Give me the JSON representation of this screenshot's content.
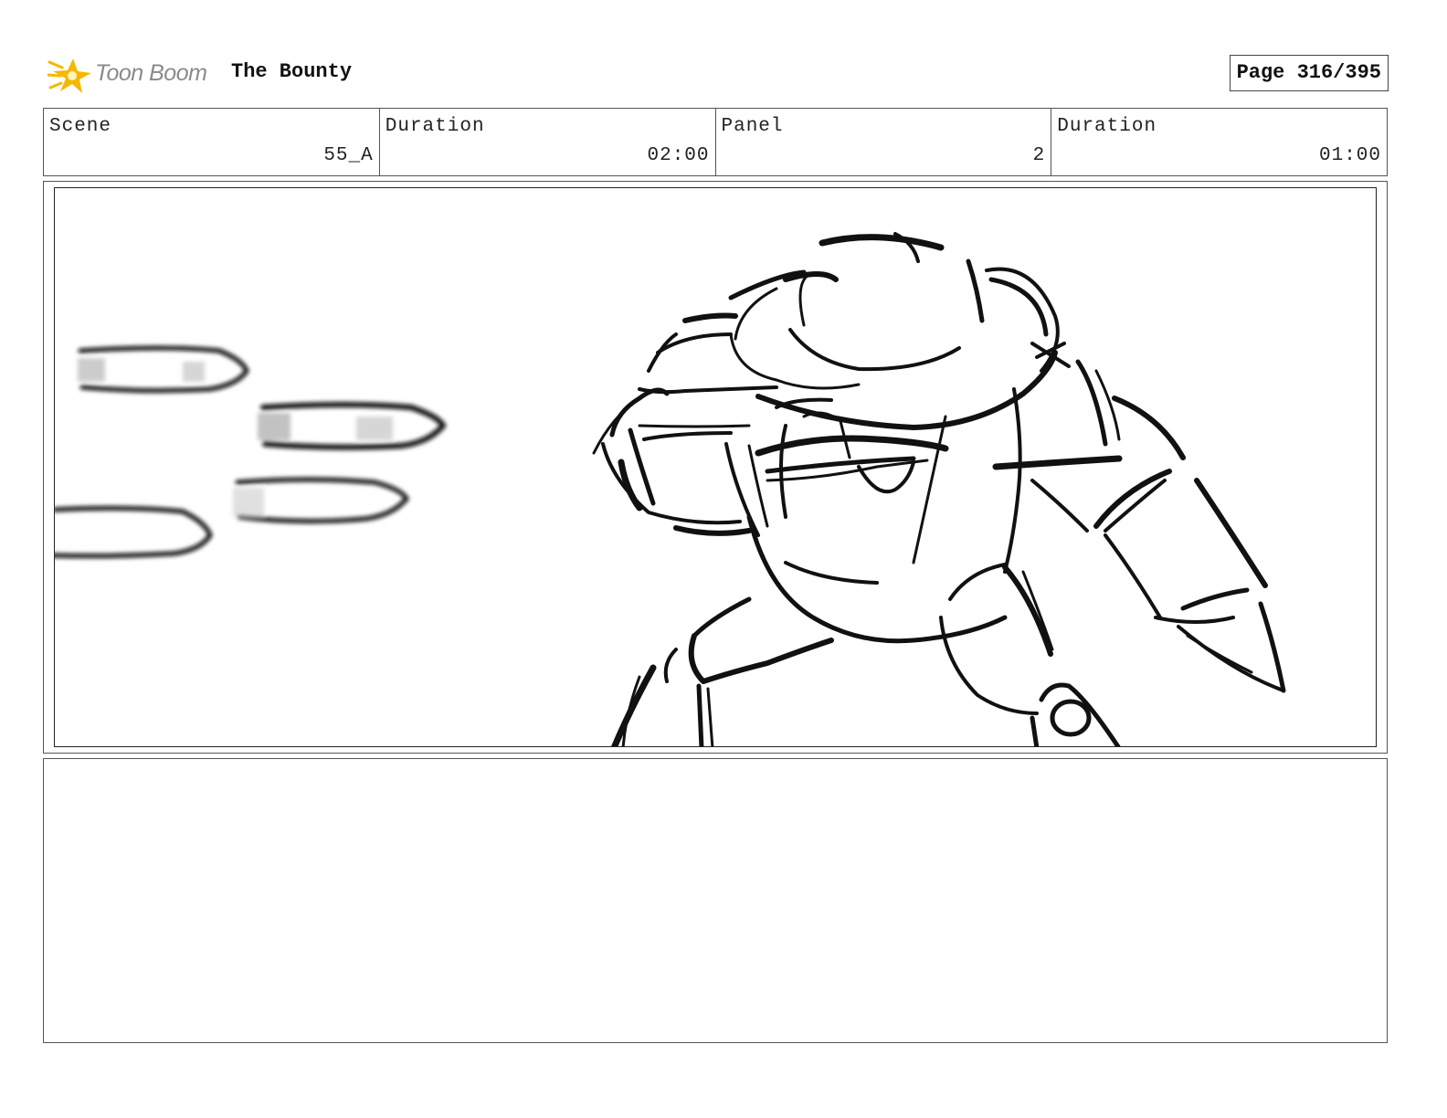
{
  "header": {
    "logo_text": "Toon Boom",
    "project_title": "The Bounty",
    "page_label": "Page 316/395"
  },
  "info": {
    "scene_label": "Scene",
    "scene_value": "55_A",
    "scene_duration_label": "Duration",
    "scene_duration_value": "02:00",
    "panel_label": "Panel",
    "panel_value": "2",
    "panel_duration_label": "Duration",
    "panel_duration_value": "01:00"
  },
  "notes": {
    "text": ""
  },
  "colors": {
    "logo_star": "#f5b800",
    "logo_text": "#8a8a8a",
    "sketch_ink": "#111111"
  }
}
